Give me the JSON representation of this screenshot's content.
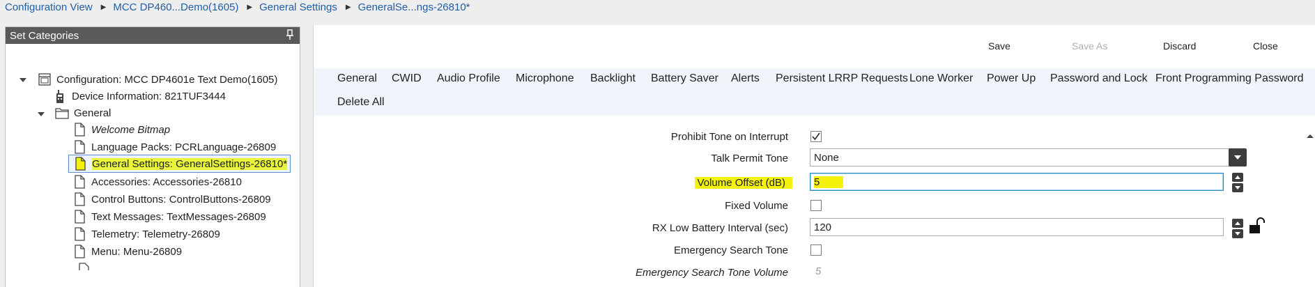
{
  "breadcrumb": [
    "Configuration View",
    "MCC DP460...Demo(1605)",
    "General Settings",
    "GeneralSe...ngs-26810*"
  ],
  "left_panel": {
    "title": "Set Categories",
    "tree": [
      {
        "label": "Configuration: MCC DP4601e Text Demo(1605)",
        "icon": "configuration-icon"
      },
      {
        "label": "Device Information: 821TUF3444",
        "icon": "radio-device-icon"
      },
      {
        "label": "General",
        "icon": "folder-icon"
      },
      {
        "label": "Welcome Bitmap",
        "icon": "document-icon"
      },
      {
        "label": "Language Packs: PCRLanguage-26809",
        "icon": "document-icon"
      },
      {
        "label": "General Settings: GeneralSettings-26810*",
        "icon": "document-icon"
      },
      {
        "label": "Accessories: Accessories-26810",
        "icon": "document-icon"
      },
      {
        "label": "Control Buttons: ControlButtons-26809",
        "icon": "document-icon"
      },
      {
        "label": "Text Messages: TextMessages-26809",
        "icon": "document-icon"
      },
      {
        "label": "Telemetry: Telemetry-26809",
        "icon": "document-icon"
      },
      {
        "label": "Menu: Menu-26809",
        "icon": "document-icon"
      }
    ]
  },
  "actions": {
    "save": "Save",
    "save_as": "Save As",
    "discard": "Discard",
    "close": "Close"
  },
  "tabs": [
    "General",
    "CWID",
    "Audio Profile",
    "Microphone",
    "Backlight",
    "Battery Saver",
    "Alerts",
    "Persistent LRRP Requests",
    "Lone Worker",
    "Power Up",
    "Password and Lock",
    "Front Programming Password",
    "Delete All"
  ],
  "form": {
    "prohibit_tone": {
      "label": "Prohibit Tone on Interrupt",
      "checked": true
    },
    "talk_permit_tone": {
      "label": "Talk Permit Tone",
      "value": "None"
    },
    "volume_offset": {
      "label": "Volume Offset (dB)",
      "value": "5"
    },
    "fixed_volume": {
      "label": "Fixed Volume",
      "checked": false
    },
    "rx_low_battery": {
      "label": "RX Low Battery Interval (sec)",
      "value": "120"
    },
    "emergency_search_tone": {
      "label": "Emergency Search Tone",
      "checked": false
    },
    "emergency_search_tone_volume": {
      "label": "Emergency Search Tone Volume",
      "value": "5"
    }
  },
  "colors": {
    "highlight": "#f5f20a",
    "link": "#1f5fa8",
    "header": "#5a5a5a",
    "tabs_bg": "#f0f5fb"
  }
}
